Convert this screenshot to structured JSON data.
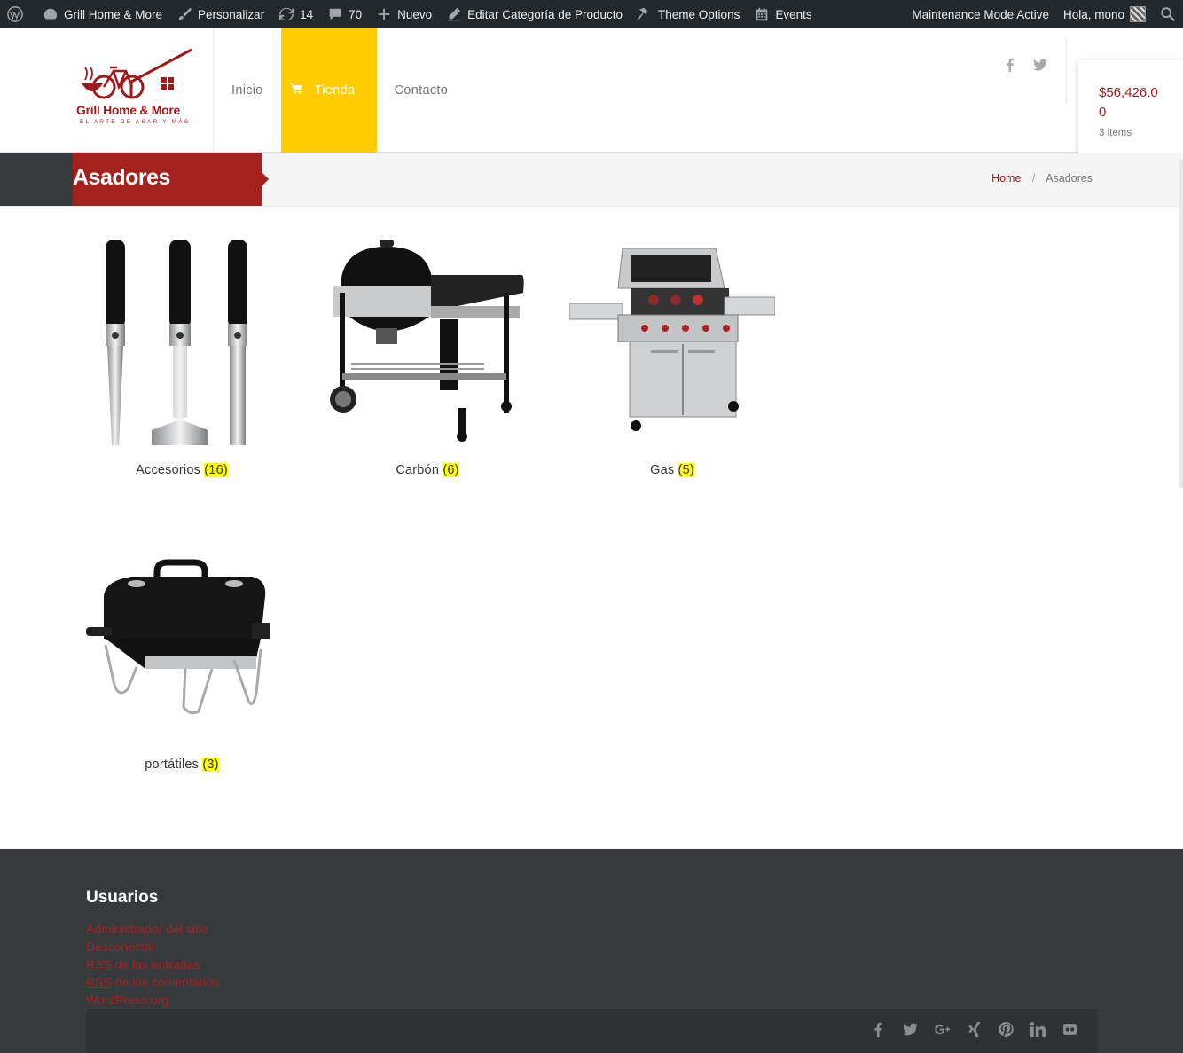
{
  "adminbar": {
    "site_name": "Grill Home & More",
    "customize": "Personalizar",
    "updates_count": "14",
    "comments_count": "70",
    "new": "Nuevo",
    "edit_category": "Editar Categoría de Producto",
    "theme_options": "Theme Options",
    "events": "Events",
    "maintenance": "Maintenance Mode Active",
    "greeting": "Hola, mono"
  },
  "logo": {
    "text": "Grill Home & More",
    "tagline": "EL ARTE DE ASAR Y MÁS"
  },
  "nav": {
    "items": [
      {
        "label": "Inicio"
      },
      {
        "label": "Tienda"
      },
      {
        "label": "Contacto"
      }
    ]
  },
  "cart": {
    "amount": "$56,426.00",
    "items": "3 items"
  },
  "page": {
    "title": "Asadores",
    "breadcrumb": {
      "home": "Home",
      "separator": "/",
      "current": "Asadores"
    }
  },
  "categories": [
    {
      "name": "Accesorios",
      "count": "(16)"
    },
    {
      "name": "Carbón",
      "count": "(6)"
    },
    {
      "name": "Gas",
      "count": "(5)"
    },
    {
      "name": "portátiles",
      "count": "(3)"
    }
  ],
  "footer": {
    "widget_title": "Usuarios",
    "links": [
      {
        "text": "Administrador del sitio"
      },
      {
        "text": "Desconectar"
      },
      {
        "abbr": "RSS",
        "text": " de las entradas"
      },
      {
        "abbr": "RSS",
        "text": " de los comentarios"
      },
      {
        "text": "WordPress.org"
      }
    ],
    "socials": [
      "facebook-icon",
      "twitter-icon",
      "google-plus-icon",
      "xing-icon",
      "pinterest-icon",
      "linkedin-icon",
      "flickr-icon"
    ]
  },
  "colors": {
    "accent_red": "#a3221e",
    "accent_yellow": "#ffcc00",
    "admin_bar": "#23282d",
    "footer": "#373a3d"
  }
}
